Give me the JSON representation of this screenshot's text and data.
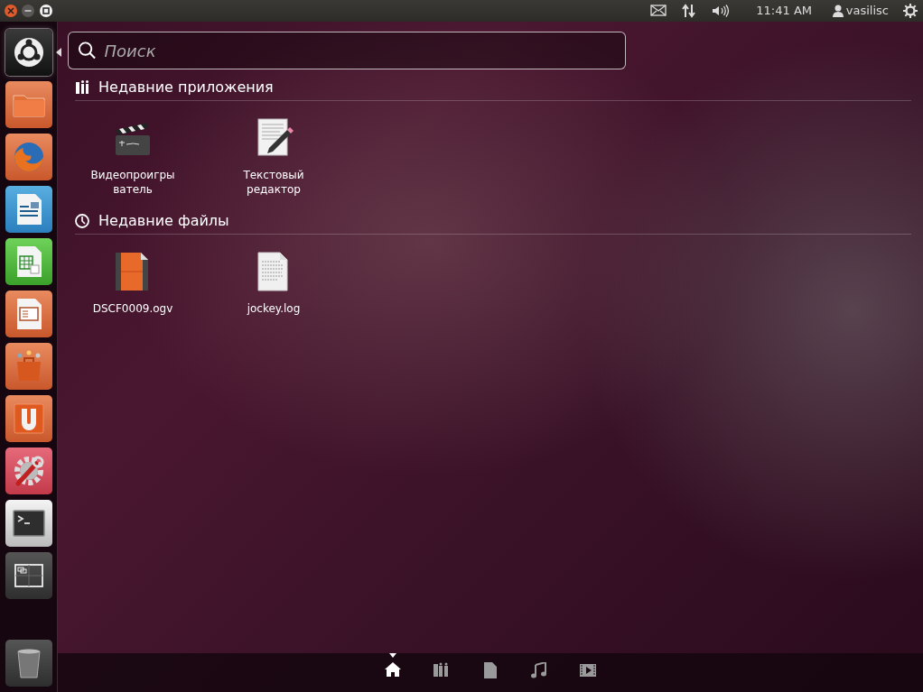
{
  "window_controls": [
    {
      "kind": "close"
    },
    {
      "kind": "minimize"
    },
    {
      "kind": "maximize"
    }
  ],
  "panel": {
    "indicators": [
      {
        "kind": "mail"
      },
      {
        "kind": "network"
      },
      {
        "kind": "sound"
      }
    ],
    "time": "11:41 AM",
    "user": "vasilisc"
  },
  "launcher": {
    "items": [
      {
        "kind": "dash",
        "selected": true
      },
      {
        "kind": "files",
        "selected": false
      },
      {
        "kind": "browser",
        "selected": false
      },
      {
        "kind": "writer",
        "selected": false
      },
      {
        "kind": "calc",
        "selected": false
      },
      {
        "kind": "impress",
        "selected": false
      },
      {
        "kind": "software",
        "selected": false
      },
      {
        "kind": "ubuntu-one",
        "selected": false
      },
      {
        "kind": "settings",
        "selected": false
      },
      {
        "kind": "terminal",
        "selected": false
      },
      {
        "kind": "workspaces",
        "selected": false
      }
    ],
    "trash": {
      "kind": "trash"
    }
  },
  "search": {
    "placeholder": "Поиск"
  },
  "sections": [
    {
      "kind": "apps",
      "title": "Недавние приложения",
      "items": [
        {
          "kind": "video-player",
          "label": "Видеопроигрыватель"
        },
        {
          "kind": "text-editor",
          "label": "Текстовый редактор"
        }
      ]
    },
    {
      "kind": "files",
      "title": "Недавние файлы",
      "items": [
        {
          "kind": "video-file",
          "label": "DSCF0009.ogv"
        },
        {
          "kind": "text-file",
          "label": "jockey.log"
        }
      ]
    }
  ],
  "lenses": [
    {
      "kind": "home",
      "selected": true
    },
    {
      "kind": "apps",
      "selected": false
    },
    {
      "kind": "files",
      "selected": false
    },
    {
      "kind": "music",
      "selected": false
    },
    {
      "kind": "video",
      "selected": false
    }
  ]
}
